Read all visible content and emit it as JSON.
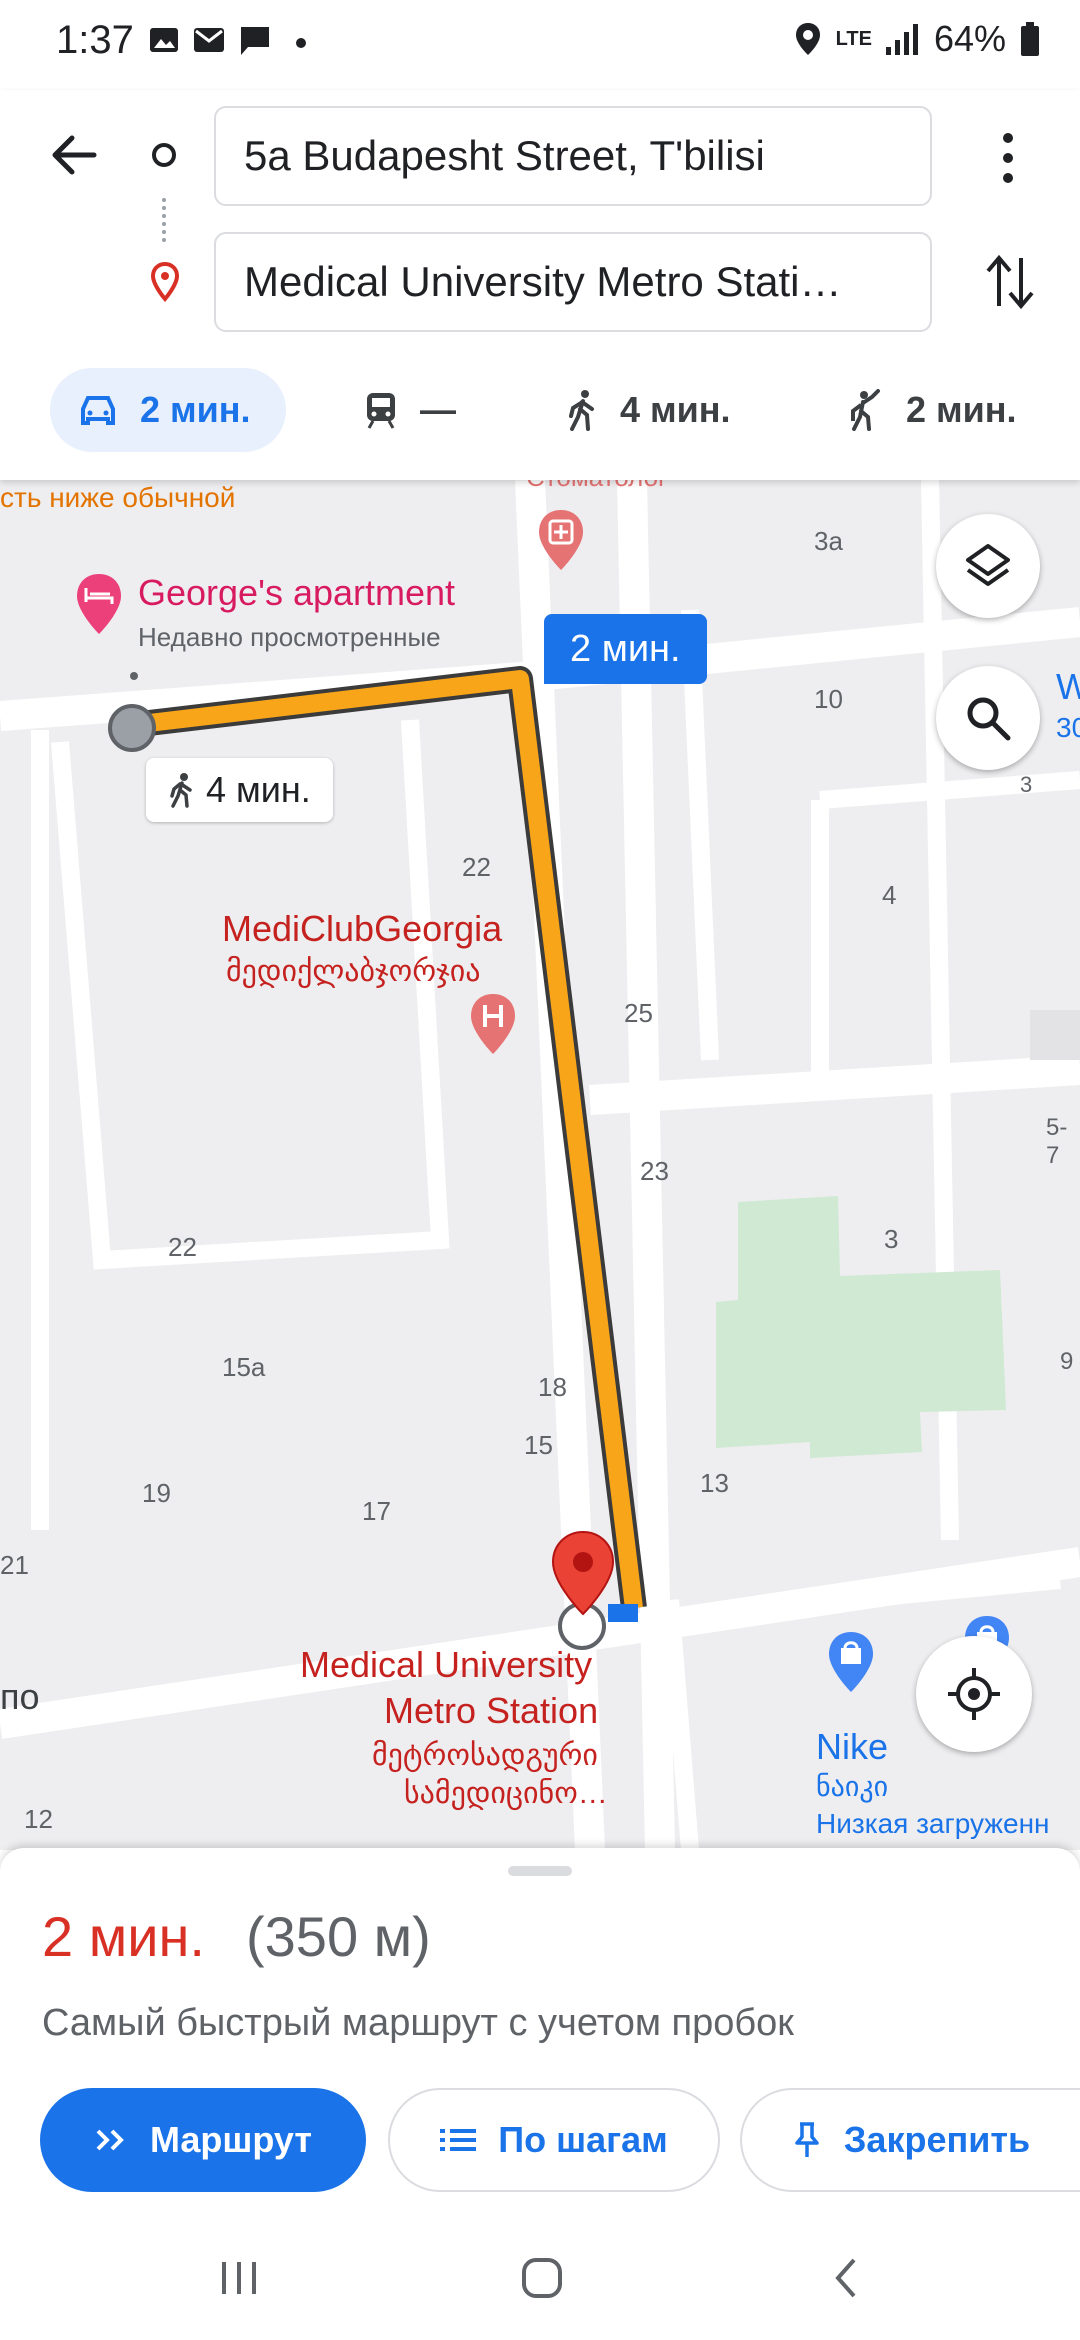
{
  "status_bar": {
    "time": "1:37",
    "network": "LTE",
    "battery": "64%"
  },
  "route": {
    "origin": "5a Budapesht Street, T'bilisi",
    "destination": "Medical University Metro Stati…"
  },
  "modes": [
    {
      "name": "drive",
      "label": "2 мин."
    },
    {
      "name": "transit",
      "label": "—"
    },
    {
      "name": "walk",
      "label": "4 мин."
    },
    {
      "name": "ride",
      "label": "2 мин."
    }
  ],
  "map": {
    "traffic_note": "сть ниже обычной",
    "dentist_label": "Стоматолог",
    "george_title": "George's apartment",
    "george_subtitle": "Недавно просмотренные",
    "drive_callout": "2 мин.",
    "walk_callout": "4 мин.",
    "mediclub_en": "MediClubGeorgia",
    "mediclub_ka": "მედიქლაბჯორჯია",
    "station_en_1": "Medical University",
    "station_en_2": "Metro Station",
    "station_ka_1": "მეტროსადგური",
    "station_ka_2": "სამედიცინო…",
    "nike_en": "Nike",
    "nike_ka": "ნაიკი",
    "nike_note": "Низкая загруженн",
    "right_w": "W",
    "right_3o": "30",
    "left_edge": "по",
    "numbers": [
      "3a",
      "10",
      "3",
      "4",
      "22",
      "25",
      "5-7",
      "23",
      "3",
      "22",
      "15a",
      "18",
      "9",
      "15",
      "13",
      "19",
      "17",
      "21",
      "12"
    ]
  },
  "summary": {
    "duration": "2 мин.",
    "distance": "(350 м)",
    "description": "Самый быстрый маршрут с учетом пробок"
  },
  "buttons": {
    "route": "Маршрут",
    "steps": "По шагам",
    "pin": "Закрепить"
  },
  "colors": {
    "accent": "#1a73e8",
    "route": "#f9a51a",
    "red": "#c5221f"
  }
}
